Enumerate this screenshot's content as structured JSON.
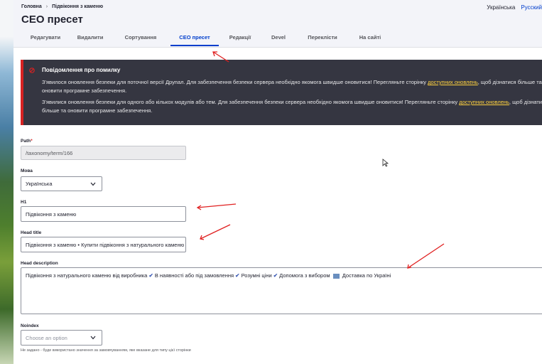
{
  "breadcrumb": {
    "home": "Головна",
    "current": "Підвіконня з каменю",
    "separator": "›"
  },
  "languages": {
    "current": "Українська",
    "other": "Русский"
  },
  "page_title": "СЕО пресет",
  "tabs": [
    {
      "label": "Редагувати"
    },
    {
      "label": "Видалити"
    },
    {
      "label": "Сортування"
    },
    {
      "label": "СЕО пресет",
      "active": true
    },
    {
      "label": "Редакції"
    },
    {
      "label": "Devel"
    },
    {
      "label": "Переклісти"
    },
    {
      "label": "На сайті"
    }
  ],
  "message": {
    "title": "Повідомлення про помилку",
    "p1_text": "З'явилося оновлення безпеки для поточної версії Друпал. Для забезпечення безпеки сервера необхідно якомога швидше оновитися! Перегляньте сторінку ",
    "p1_link": "доступних оновлень",
    "p1_after": ", щоб дізнатися більше та оновити програмне забезпечення.",
    "p2_text": "З'явилися оновлення безпеки для одного або кількох модулів або тем. Для забезпечення безпеки сервера необхідно якомога швидше оновитися! Перегляньте сторінку ",
    "p2_link": "доступних оновлень",
    "p2_after": ", щоб дізнатися більше та оновити програмне забезпечення."
  },
  "form": {
    "path_label": "Path",
    "path_required": "*",
    "path_value": "/taxonomy/term/166",
    "lang_label": "Мова",
    "lang_value": "Українська",
    "h1_label": "H1",
    "h1_value": "Підвіконня з каменю",
    "head_title_label": "Head title",
    "head_title_value": "Підвіконня з каменю • Купити підвіконня з натурального каменю",
    "head_desc_label": "Head description",
    "head_desc_parts": {
      "a": "Підвіконня з натурального каменю від виробника",
      "b": "В наявності або під замовлення",
      "c": "Розумні ціни",
      "d": "Допомога з вибором",
      "e": "Доставка по Україні"
    },
    "check_glyph": "✔",
    "noindex_label": "Noindex",
    "noindex_placeholder": "Choose an option",
    "noindex_hint": "Не задано - буде використано значення за замовчуванням, яке вказане для типу цієї сторінки"
  },
  "colors": {
    "accent": "#003ecc",
    "error": "#d72222",
    "annotation_arrow": "#e02020",
    "message_bg": "#353641",
    "link_yellow": "#ffd23f"
  }
}
